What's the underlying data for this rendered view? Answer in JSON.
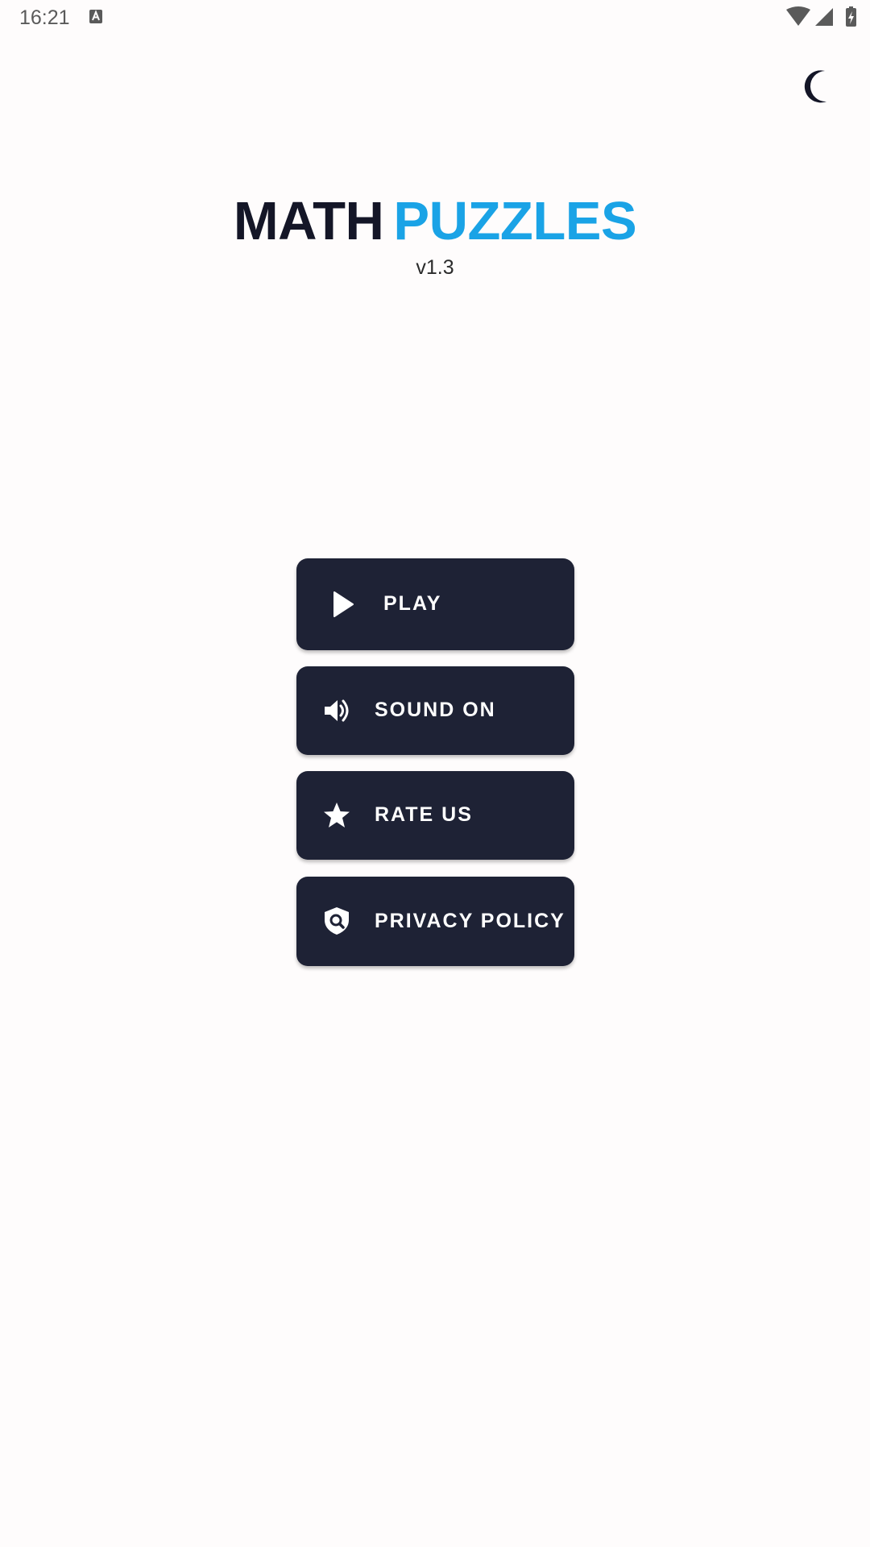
{
  "status_bar": {
    "time": "16:21",
    "icons": [
      "notification-a-icon",
      "wifi-icon",
      "cell-signal-icon",
      "battery-charging-icon"
    ]
  },
  "theme_toggle": {
    "icon": "moon-icon"
  },
  "title": {
    "part1": "MATH",
    "part2": "PUZZLES",
    "version": "v1.3"
  },
  "colors": {
    "background": "#fefcfc",
    "title_dark": "#141627",
    "title_accent": "#1aa3e6",
    "button_bg": "#1e2235",
    "button_text": "#ffffff"
  },
  "menu": {
    "play": {
      "label": "PLAY",
      "icon": "play-icon"
    },
    "sound": {
      "label": "SOUND ON",
      "icon": "volume-icon"
    },
    "rate": {
      "label": "RATE US",
      "icon": "star-icon"
    },
    "privacy": {
      "label": "PRIVACY POLICY",
      "icon": "shield-search-icon"
    }
  }
}
